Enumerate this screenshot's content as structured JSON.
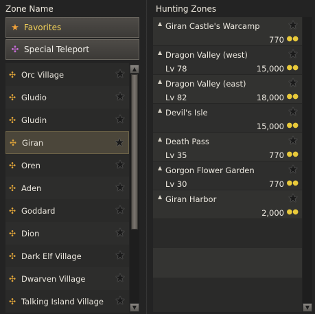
{
  "left_panel": {
    "title": "Zone Name",
    "favorites_label": "Favorites",
    "special_teleport_label": "Special Teleport",
    "towns": [
      {
        "label": "Orc Village",
        "selected": false
      },
      {
        "label": "Gludio",
        "selected": false
      },
      {
        "label": "Gludin",
        "selected": false
      },
      {
        "label": "Giran",
        "selected": true
      },
      {
        "label": "Oren",
        "selected": false
      },
      {
        "label": "Aden",
        "selected": false
      },
      {
        "label": "Goddard",
        "selected": false
      },
      {
        "label": "Dion",
        "selected": false
      },
      {
        "label": "Dark Elf Village",
        "selected": false
      },
      {
        "label": "Dwarven Village",
        "selected": false
      },
      {
        "label": "Talking Island Village",
        "selected": false
      }
    ]
  },
  "right_panel": {
    "title": "Hunting Zones",
    "zones": [
      {
        "name": "Giran Castle's Warcamp",
        "level": "",
        "cost": "770"
      },
      {
        "name": "Dragon Valley (west)",
        "level": "Lv 78",
        "cost": "15,000"
      },
      {
        "name": "Dragon Valley (east)",
        "level": "Lv 82",
        "cost": "18,000"
      },
      {
        "name": "Devil's Isle",
        "level": "",
        "cost": "15,000"
      },
      {
        "name": "Death Pass",
        "level": "Lv 35",
        "cost": "770"
      },
      {
        "name": "Gorgon Flower Garden",
        "level": "Lv 30",
        "cost": "770"
      },
      {
        "name": "Giran Harbor",
        "level": "",
        "cost": "2,000"
      }
    ]
  },
  "icons": {
    "favorites": "star-icon",
    "special_teleport": "spiral-icon",
    "town": "teleport-spiral-icon",
    "bookmark": "star-outline-icon",
    "currency": "adena-icon"
  },
  "colors": {
    "background": "#232323",
    "favorites_text": "#f2d15a",
    "selected_row": "#4b463a",
    "adena": "#e8c93a"
  }
}
